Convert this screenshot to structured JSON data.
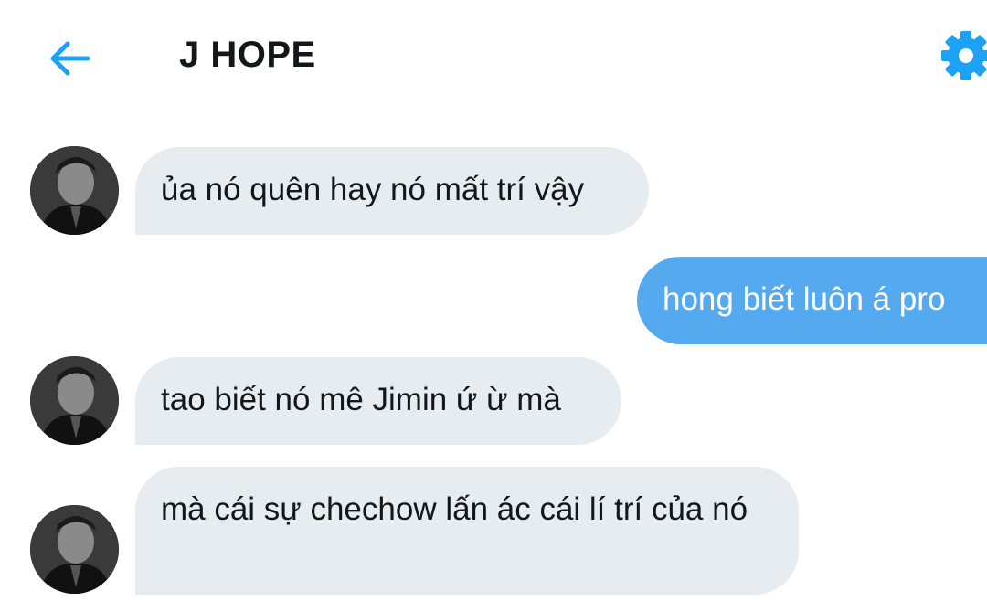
{
  "header": {
    "title": "J HOPE",
    "back_icon": "arrow-left-icon",
    "settings_icon": "gear-icon",
    "accent_color": "#1da1f2"
  },
  "messages": [
    {
      "direction": "incoming",
      "text": "ủa nó quên hay nó mất trí vậy"
    },
    {
      "direction": "outgoing",
      "text": "hong biết luôn á pro"
    },
    {
      "direction": "incoming",
      "text": "tao biết nó mê Jimin ứ ừ mà"
    },
    {
      "direction": "incoming",
      "text": "mà cái sự chechow lấn ác cái lí trí của nó"
    }
  ],
  "colors": {
    "incoming_bubble": "#e6ecf0",
    "outgoing_bubble": "#55a9ee",
    "text": "#14171a"
  }
}
